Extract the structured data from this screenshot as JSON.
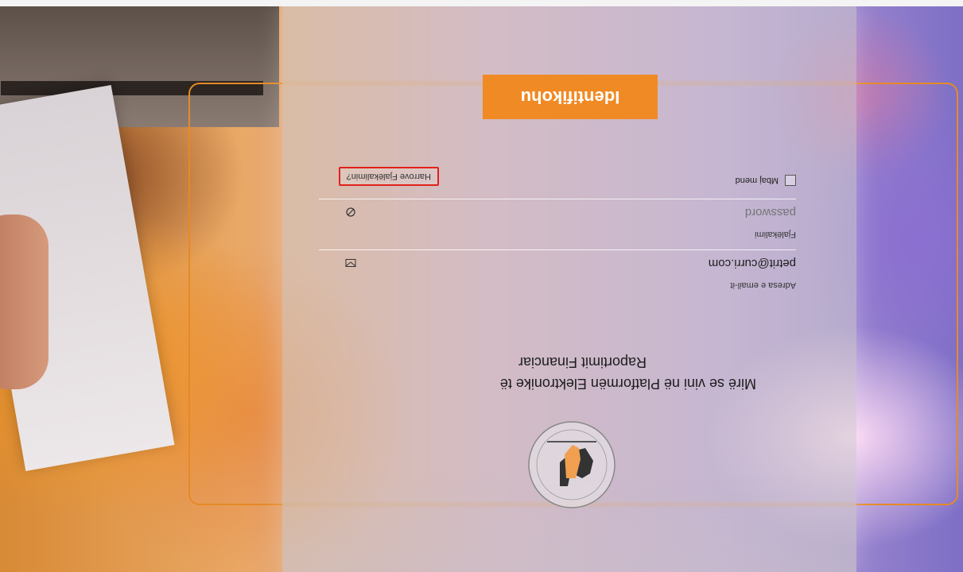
{
  "login": {
    "title_line1": "Mirë se vini në Platformën Elektronike të",
    "title_line2": "Raportimit Financiar",
    "email": {
      "label": "Adresa e email-it",
      "value": "petrit@curri.com"
    },
    "password": {
      "label": "Fjalëkalimi",
      "placeholder": "password"
    },
    "remember_label": "Mbaj mend",
    "forgot_label": "Harrove Fjalëkalimin?",
    "submit_label": "Identifikohu"
  },
  "colors": {
    "accent": "#f08a24",
    "highlight_border": "#e0211a"
  },
  "icons": {
    "email_field": "envelope-icon",
    "password_field": "eye-slash-icon",
    "logo": "emblem-logo"
  }
}
